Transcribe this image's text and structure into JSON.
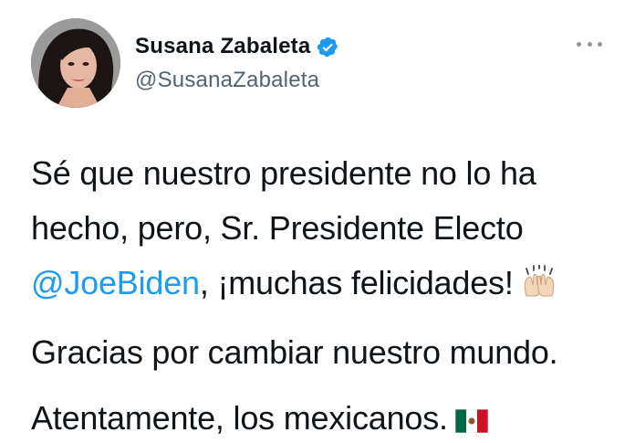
{
  "author": {
    "display_name": "Susana Zabaleta",
    "handle": "@SusanaZabaleta",
    "verified_icon": "verified-badge-icon",
    "avatar_icon": "avatar-photo"
  },
  "menu": {
    "icon": "more-options-icon"
  },
  "tweet": {
    "line1_a": "Sé que nuestro presidente no lo ha hecho, pero, Sr. Presidente Electo",
    "mention": "@JoeBiden",
    "line1_b": ", ¡muchas felicidades!",
    "emoji1": "raising-hands-emoji",
    "line2": "Gracias por cambiar nuestro mundo.",
    "line3": "Atentamente, los mexicanos.",
    "emoji2": "mexico-flag-emoji"
  },
  "colors": {
    "link": "#1d9bf0",
    "verified": "#1d9bf0",
    "secondary_text": "#536471"
  }
}
